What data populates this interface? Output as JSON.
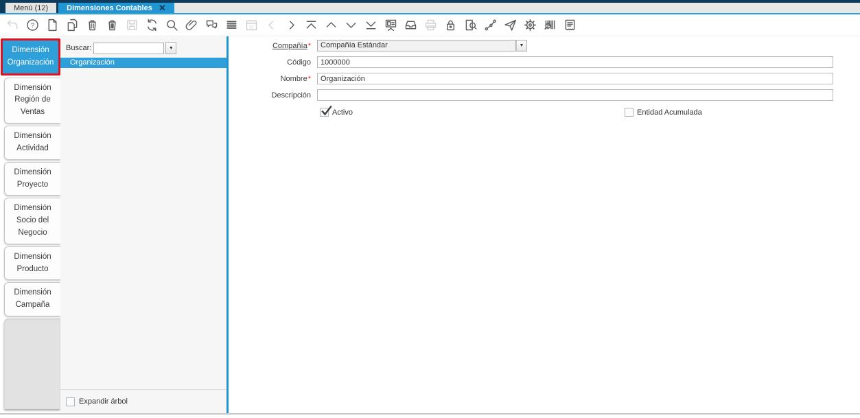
{
  "titlebar": {
    "tabs": [
      {
        "label": "Menú (12)",
        "active": false
      },
      {
        "label": "Dimensiones Contables",
        "active": true,
        "closable": true
      }
    ]
  },
  "toolbar": {
    "buttons": [
      {
        "name": "undo",
        "disabled": true
      },
      {
        "name": "help",
        "disabled": false
      },
      {
        "name": "new-record",
        "disabled": false
      },
      {
        "name": "copy-record",
        "disabled": false
      },
      {
        "name": "delete",
        "disabled": false
      },
      {
        "name": "delete-selection",
        "disabled": false
      },
      {
        "name": "save",
        "disabled": true
      },
      {
        "name": "refresh",
        "disabled": false
      },
      {
        "name": "find",
        "disabled": false
      },
      {
        "name": "attachment",
        "disabled": false
      },
      {
        "name": "chat",
        "disabled": false
      },
      {
        "name": "grid-toggle",
        "disabled": false
      },
      {
        "name": "calendar",
        "disabled": true
      },
      {
        "name": "parent-record",
        "disabled": true
      },
      {
        "name": "detail-record",
        "disabled": false
      },
      {
        "name": "first-record",
        "disabled": false
      },
      {
        "name": "previous-record",
        "disabled": false
      },
      {
        "name": "next-record",
        "disabled": false
      },
      {
        "name": "last-record",
        "disabled": false
      },
      {
        "name": "report",
        "disabled": false
      },
      {
        "name": "archive",
        "disabled": false
      },
      {
        "name": "print",
        "disabled": true
      },
      {
        "name": "lock",
        "disabled": false
      },
      {
        "name": "zoom-across",
        "disabled": false
      },
      {
        "name": "workflow",
        "disabled": false
      },
      {
        "name": "send",
        "disabled": false
      },
      {
        "name": "preference",
        "disabled": false
      },
      {
        "name": "barcode",
        "disabled": false
      },
      {
        "name": "print-preview",
        "disabled": false
      }
    ]
  },
  "sidebar": {
    "tabs": [
      {
        "label": "Dimensión Organización",
        "selected": true
      },
      {
        "label": "Dimensión Región de Ventas",
        "selected": false
      },
      {
        "label": "Dimensión Actividad",
        "selected": false
      },
      {
        "label": "Dimensión Proyecto",
        "selected": false
      },
      {
        "label": "Dimensión Socio del Negocio",
        "selected": false
      },
      {
        "label": "Dimensión Producto",
        "selected": false
      },
      {
        "label": "Dimensión Campaña",
        "selected": false
      }
    ]
  },
  "tree_panel": {
    "search_label": "Buscar:",
    "search_value": "",
    "nodes": [
      {
        "label": "Organización",
        "selected": true
      }
    ],
    "expand_label": "Expandir árbol",
    "expand_checked": false
  },
  "form": {
    "fields": [
      {
        "label": "Compañía",
        "required": true,
        "value": "Compañía Estándar",
        "type": "select",
        "readonly": true
      },
      {
        "label": "Código",
        "required": false,
        "value": "1000000",
        "type": "text"
      },
      {
        "label": "Nombre",
        "required": true,
        "value": "Organización",
        "type": "text"
      },
      {
        "label": "Descripción",
        "required": false,
        "value": "",
        "type": "text"
      }
    ],
    "checkboxes": [
      {
        "label": "Activo",
        "checked": true
      },
      {
        "label": "Entidad Acumulada",
        "checked": false
      }
    ]
  },
  "colors": {
    "accent_blue": "#2196D3",
    "selected_blue": "#2E9FD8",
    "topbar_navy": "#0E3A5C",
    "highlight_red": "#E2111B",
    "required_red": "#E8251F"
  }
}
